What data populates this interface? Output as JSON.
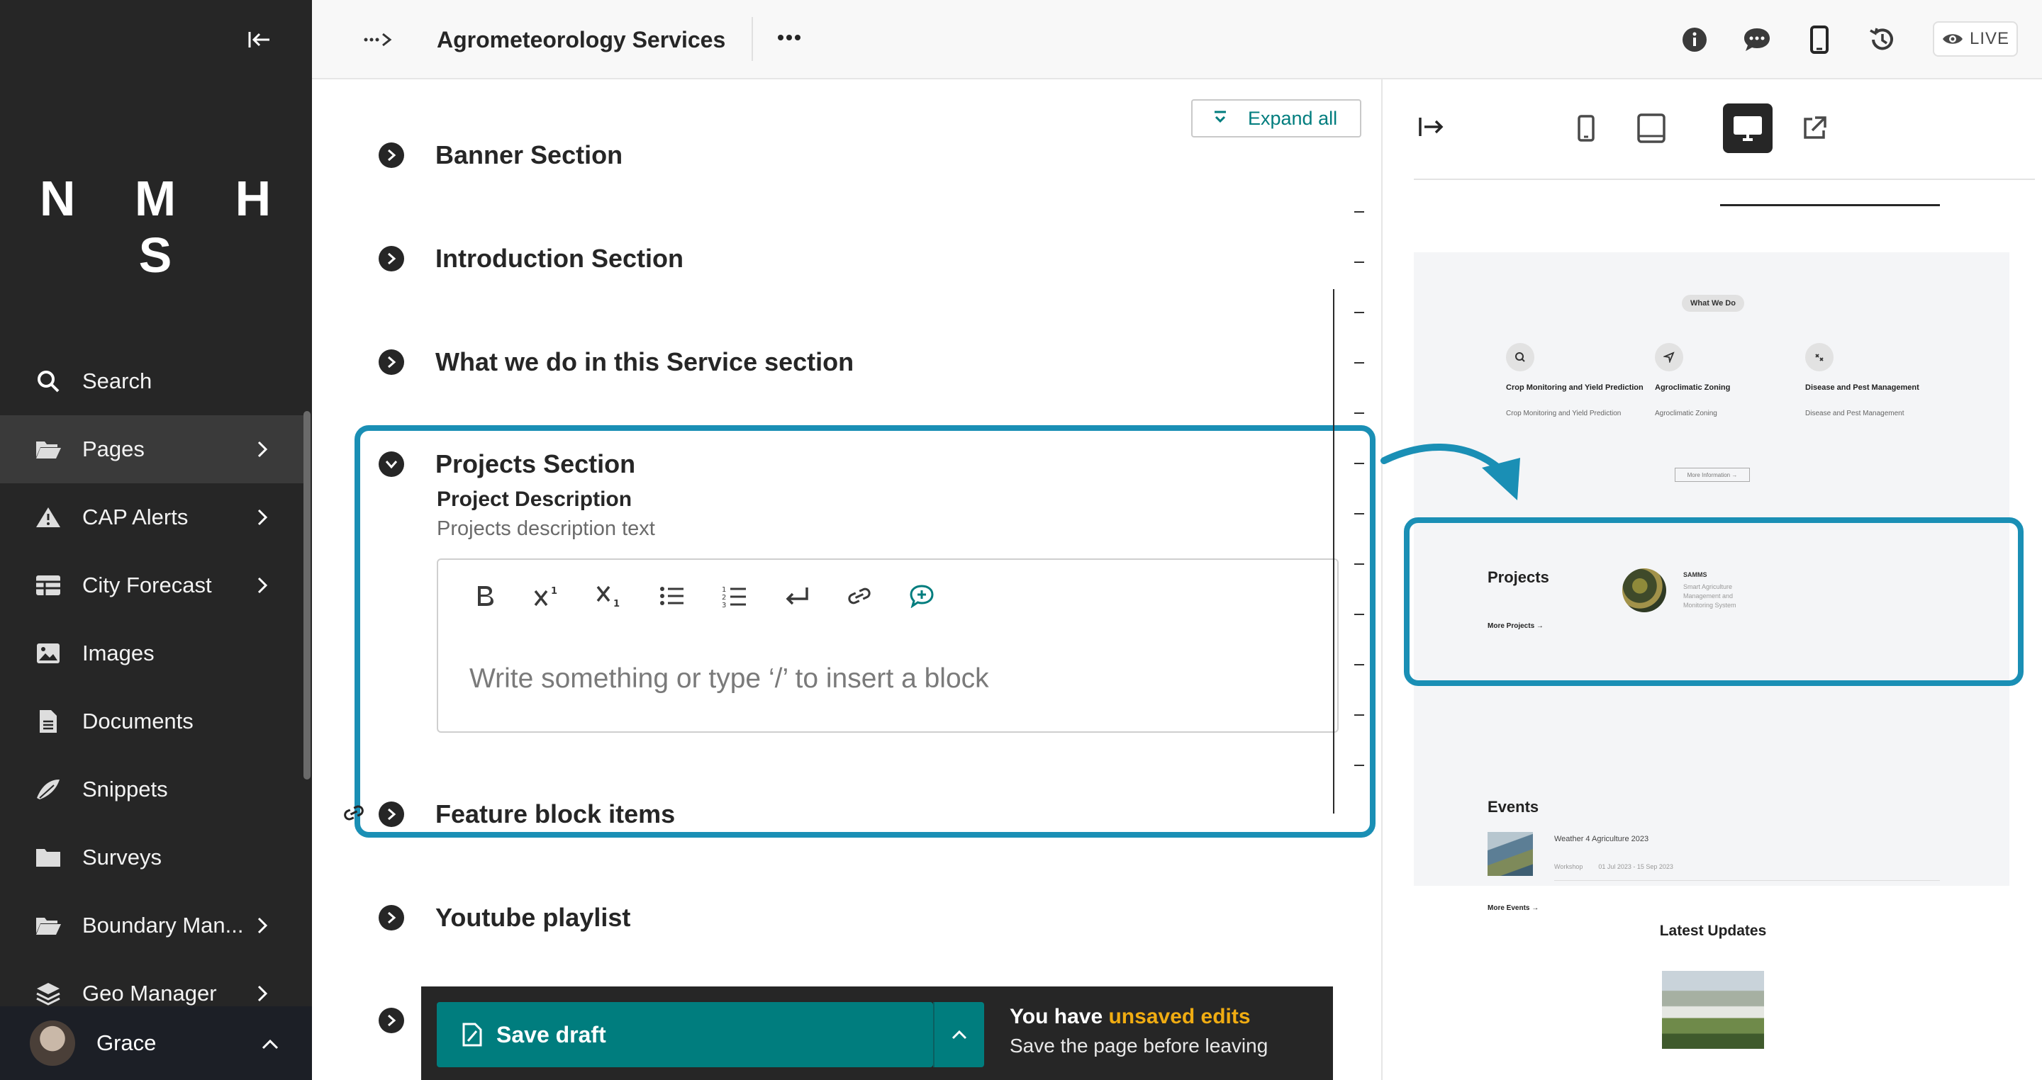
{
  "sidebar": {
    "logo": "N M H S",
    "items": [
      {
        "label": "Search",
        "icon": "search-icon"
      },
      {
        "label": "Pages",
        "icon": "folder-open-icon"
      },
      {
        "label": "CAP Alerts",
        "icon": "warning-icon"
      },
      {
        "label": "City Forecast",
        "icon": "table-icon"
      },
      {
        "label": "Images",
        "icon": "image-icon"
      },
      {
        "label": "Documents",
        "icon": "document-icon"
      },
      {
        "label": "Snippets",
        "icon": "snippet-icon"
      },
      {
        "label": "Surveys",
        "icon": "folder-icon"
      },
      {
        "label": "Boundary Man...",
        "icon": "folder-open-icon"
      },
      {
        "label": "Geo Manager",
        "icon": "layers-icon"
      }
    ],
    "user": "Grace"
  },
  "header": {
    "title": "Agrometeorology Services",
    "live_label": "LIVE"
  },
  "editor": {
    "expand_all": "Expand all",
    "sections": [
      "Banner Section",
      "Introduction Section",
      "What we do in this Service section",
      "Projects Section",
      "Feature block items",
      "Youtube playlist"
    ],
    "project": {
      "field_label": "Project Description",
      "help_text": "Projects description text",
      "placeholder": "Write something or type ‘/’ to insert a block"
    }
  },
  "savebar": {
    "save_label": "Save draft",
    "msg_prefix": "You have ",
    "msg_highlight": "unsaved edits",
    "msg_sub": "Save the page before leaving"
  },
  "preview": {
    "what_we_do_pill": "What We Do",
    "what_items": [
      {
        "title": "Crop Monitoring and Yield Prediction",
        "desc": "Crop Monitoring and Yield Prediction"
      },
      {
        "title": "Agroclimatic Zoning",
        "desc": "Agroclimatic Zoning"
      },
      {
        "title": "Disease and Pest Management",
        "desc": "Disease and Pest Management"
      }
    ],
    "more_information": "More Information →",
    "projects_title": "Projects",
    "projects_more": "More Projects →",
    "project_name": "SAMMS",
    "project_desc": "Smart Agriculture Management and Monitoring System",
    "events_title": "Events",
    "event_name": "Weather 4 Agriculture 2023",
    "event_type": "Workshop",
    "event_dates": "01 Jul 2023 - 15 Sep 2023",
    "events_more": "More Events →",
    "latest_updates": "Latest Updates"
  },
  "colors": {
    "sidebar_bg": "#262626",
    "teal": "#007d7e",
    "highlight_box": "#1a8fb5",
    "unsaved": "#f0ac12"
  }
}
